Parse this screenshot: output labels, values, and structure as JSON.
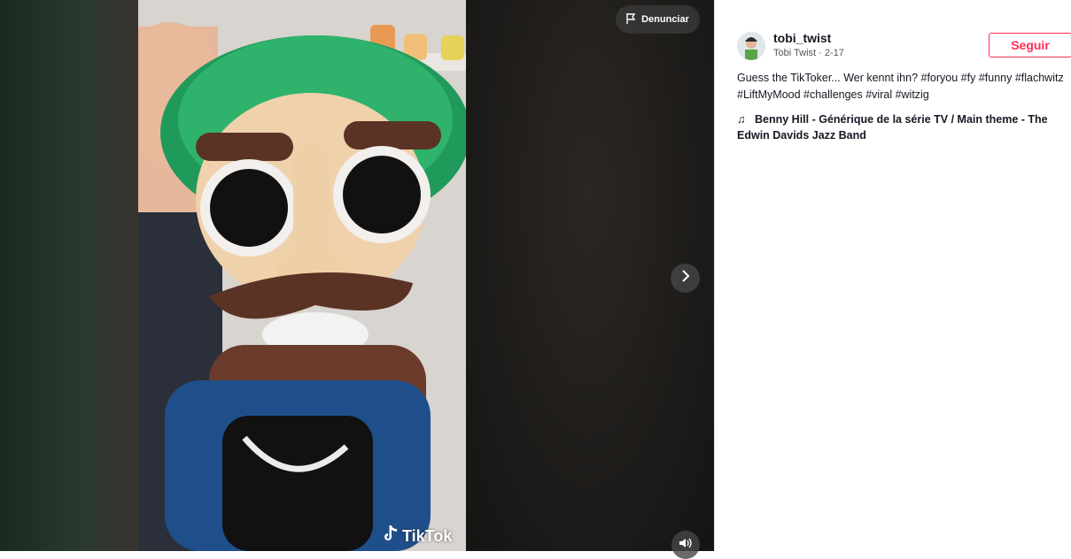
{
  "actions": {
    "report_label": "Denunciar"
  },
  "video": {
    "watermark": "TikTok"
  },
  "author": {
    "username": "tobi_twist",
    "display_name": "Tobi Twist",
    "date": "2-17",
    "subline": "Tobi Twist · 2-17",
    "follow_label": "Seguir"
  },
  "post": {
    "description": "Guess the TikToker... Wer kennt ihn? #foryou #fy #funny #flachwitz #LiftMyMood #challenges #viral #witzig",
    "music": "Benny Hill - Générique de la série TV / Main theme - The Edwin Davids Jazz Band"
  },
  "icons": {
    "report": "flag-icon",
    "next": "chevron-right-icon",
    "volume": "speaker-icon",
    "music": "music-note-icon",
    "logo": "tiktok-logo-icon"
  },
  "colors": {
    "accent": "#fe2c55",
    "text": "#161823"
  }
}
